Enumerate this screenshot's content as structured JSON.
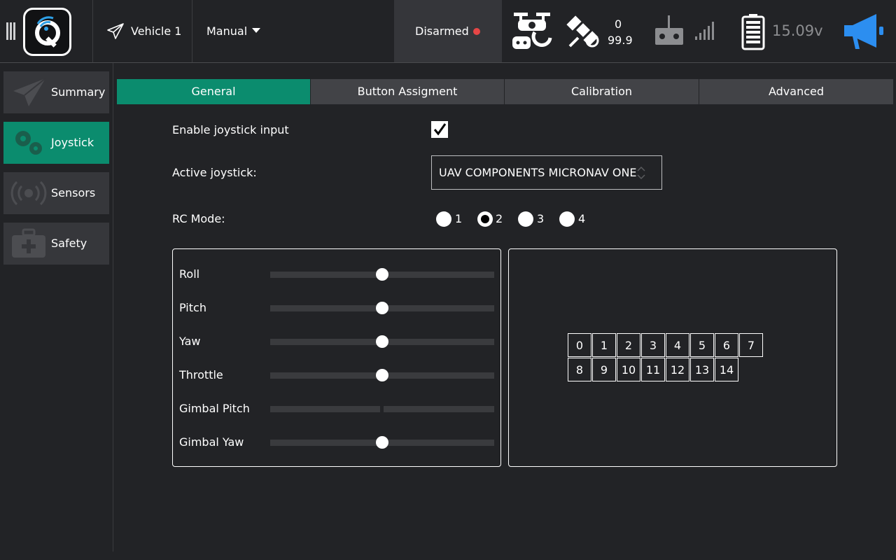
{
  "toolbar": {
    "vehicle_label": "Vehicle 1",
    "flight_mode": "Manual",
    "arm_status": "Disarmed",
    "gps_count": "0",
    "gps_hdop": "99.9",
    "battery_voltage": "15.09v",
    "status_dot_color": "#e64646",
    "accent_color": "#2c8ef0"
  },
  "nav": {
    "items": [
      {
        "label": "Summary",
        "icon": "paper-plane-icon"
      },
      {
        "label": "Joystick",
        "icon": "gears-icon"
      },
      {
        "label": "Sensors",
        "icon": "radio-waves-icon"
      },
      {
        "label": "Safety",
        "icon": "medkit-icon"
      }
    ],
    "active_color": "#0b8c6e"
  },
  "tabs": [
    "General",
    "Button Assigment",
    "Calibration",
    "Advanced"
  ],
  "general": {
    "enable_label": "Enable joystick input",
    "enable_checked": true,
    "active_label": "Active joystick:",
    "active_value": "UAV COMPONENTS MICRONAV ONE",
    "rc_mode_label": "RC Mode:",
    "rc_modes": [
      "1",
      "2",
      "3",
      "4"
    ],
    "rc_mode_selected": "2"
  },
  "axes": [
    {
      "label": "Roll",
      "value": 0.5
    },
    {
      "label": "Pitch",
      "value": 0.5
    },
    {
      "label": "Yaw",
      "value": 0.5
    },
    {
      "label": "Throttle",
      "value": 0.5
    },
    {
      "label": "Gimbal Pitch",
      "value": null
    },
    {
      "label": "Gimbal Yaw",
      "value": 0.5
    }
  ],
  "buttons": [
    "0",
    "1",
    "2",
    "3",
    "4",
    "5",
    "6",
    "7",
    "8",
    "9",
    "10",
    "11",
    "12",
    "13",
    "14"
  ]
}
